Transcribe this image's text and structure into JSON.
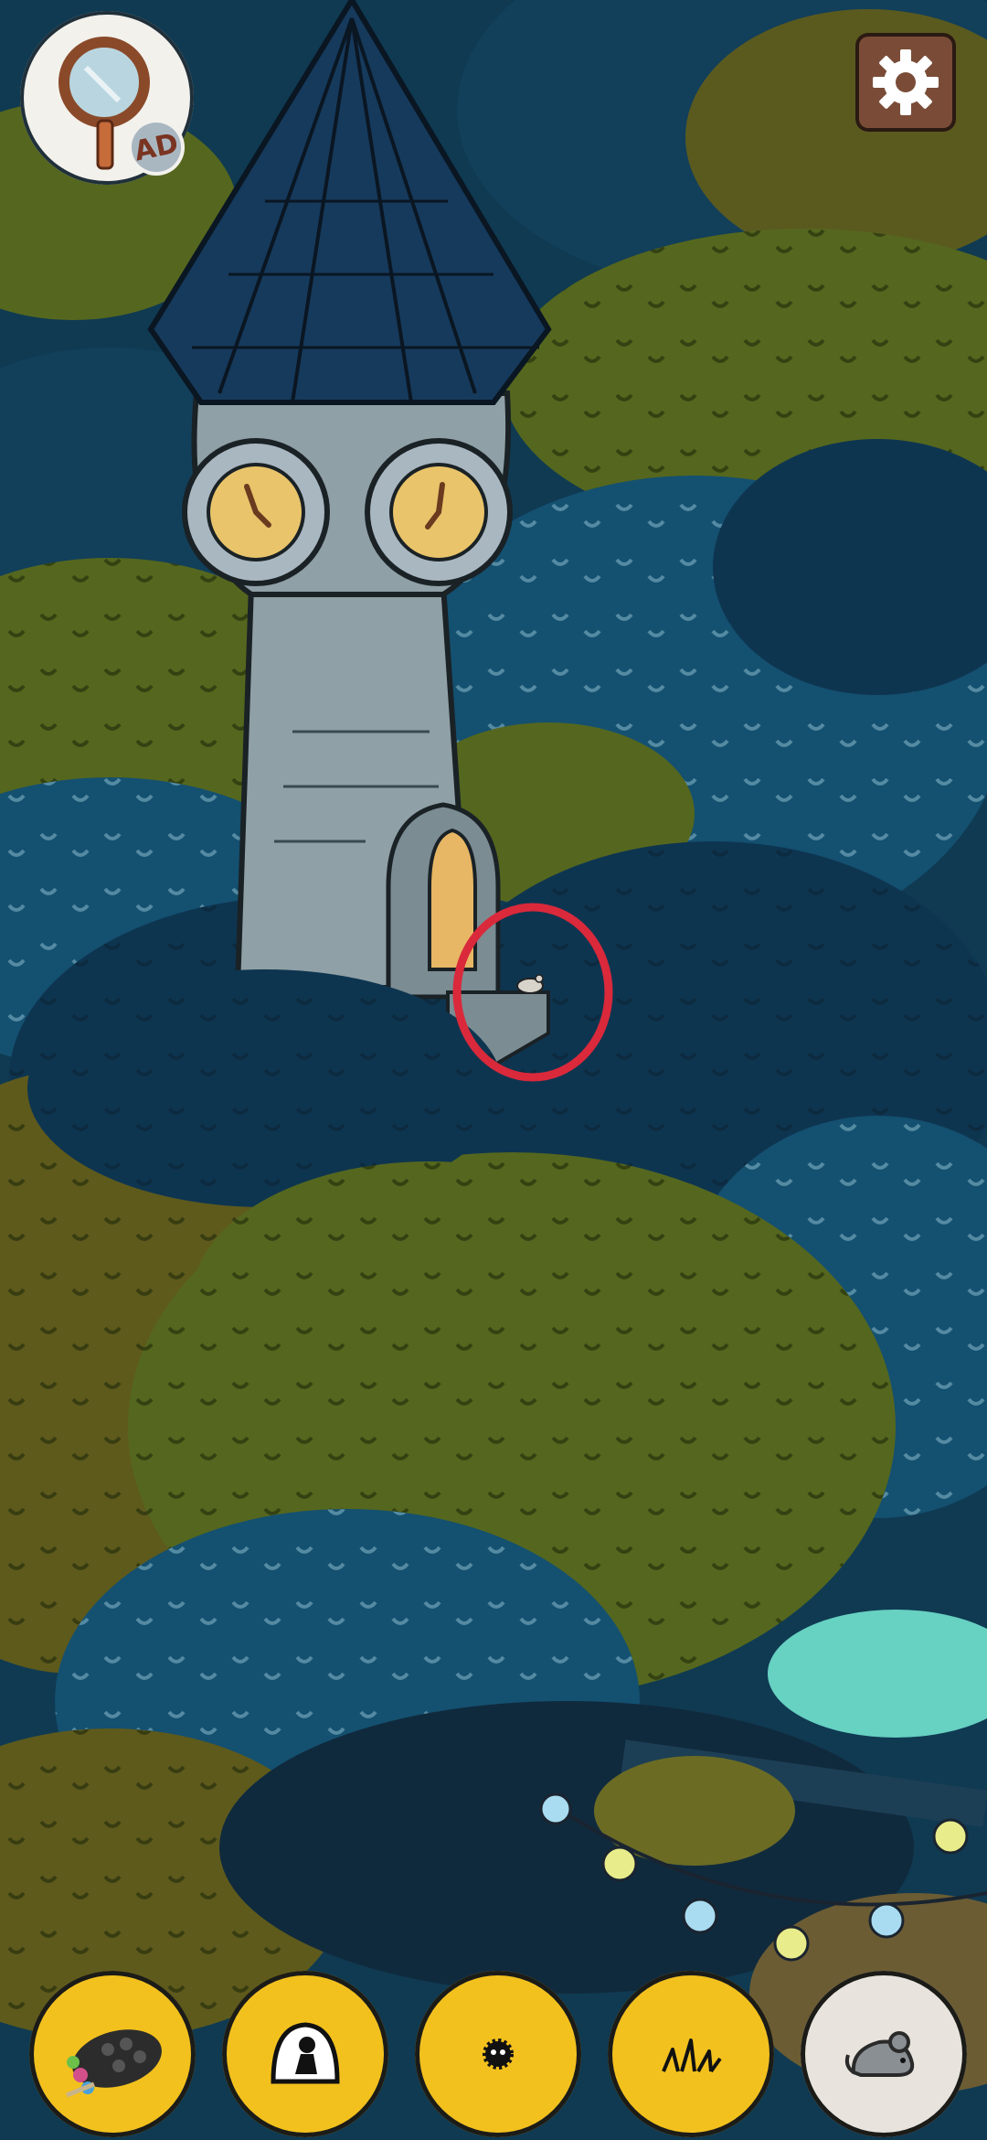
{
  "hud": {
    "hint_button_icon": "magnifier-icon",
    "ad_badge": "AD",
    "settings_icon": "gear-icon"
  },
  "marker": {
    "icon": "mouse-icon",
    "color": "#d9293b"
  },
  "toolbar": {
    "items": [
      {
        "icon": "palette-icon",
        "selected": false
      },
      {
        "icon": "silhouette-icon",
        "selected": false
      },
      {
        "icon": "soot-sprite-icon",
        "selected": false
      },
      {
        "icon": "grass-icon",
        "selected": false
      },
      {
        "icon": "mouse-icon",
        "selected": true
      }
    ]
  },
  "colors": {
    "tree_blue": "#145070",
    "tree_dark": "#0e3550",
    "tree_green": "#55671e",
    "tree_olive": "#5e5a1c",
    "tower_stone": "#8fa0a6",
    "tool_yellow": "#f3c11e"
  }
}
